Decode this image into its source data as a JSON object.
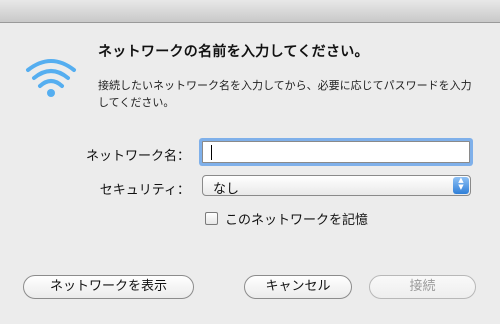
{
  "dialog": {
    "headline": "ネットワークの名前を入力してください。",
    "description": "接続したいネットワーク名を入力してから、必要に応じてパスワードを入力してください。"
  },
  "form": {
    "network_label": "ネットワーク名：",
    "network_value": "",
    "security_label": "セキュリティ：",
    "security_value": "なし",
    "remember_label": "このネットワークを記憶",
    "remember_checked": false
  },
  "buttons": {
    "show_networks": "ネットワークを表示",
    "cancel": "キャンセル",
    "join": "接続"
  },
  "icons": {
    "wifi": "wifi-icon",
    "select_arrows": "up-down-arrows-icon"
  },
  "colors": {
    "accent": "#2f7fd8",
    "wifi": "#55aef0"
  }
}
